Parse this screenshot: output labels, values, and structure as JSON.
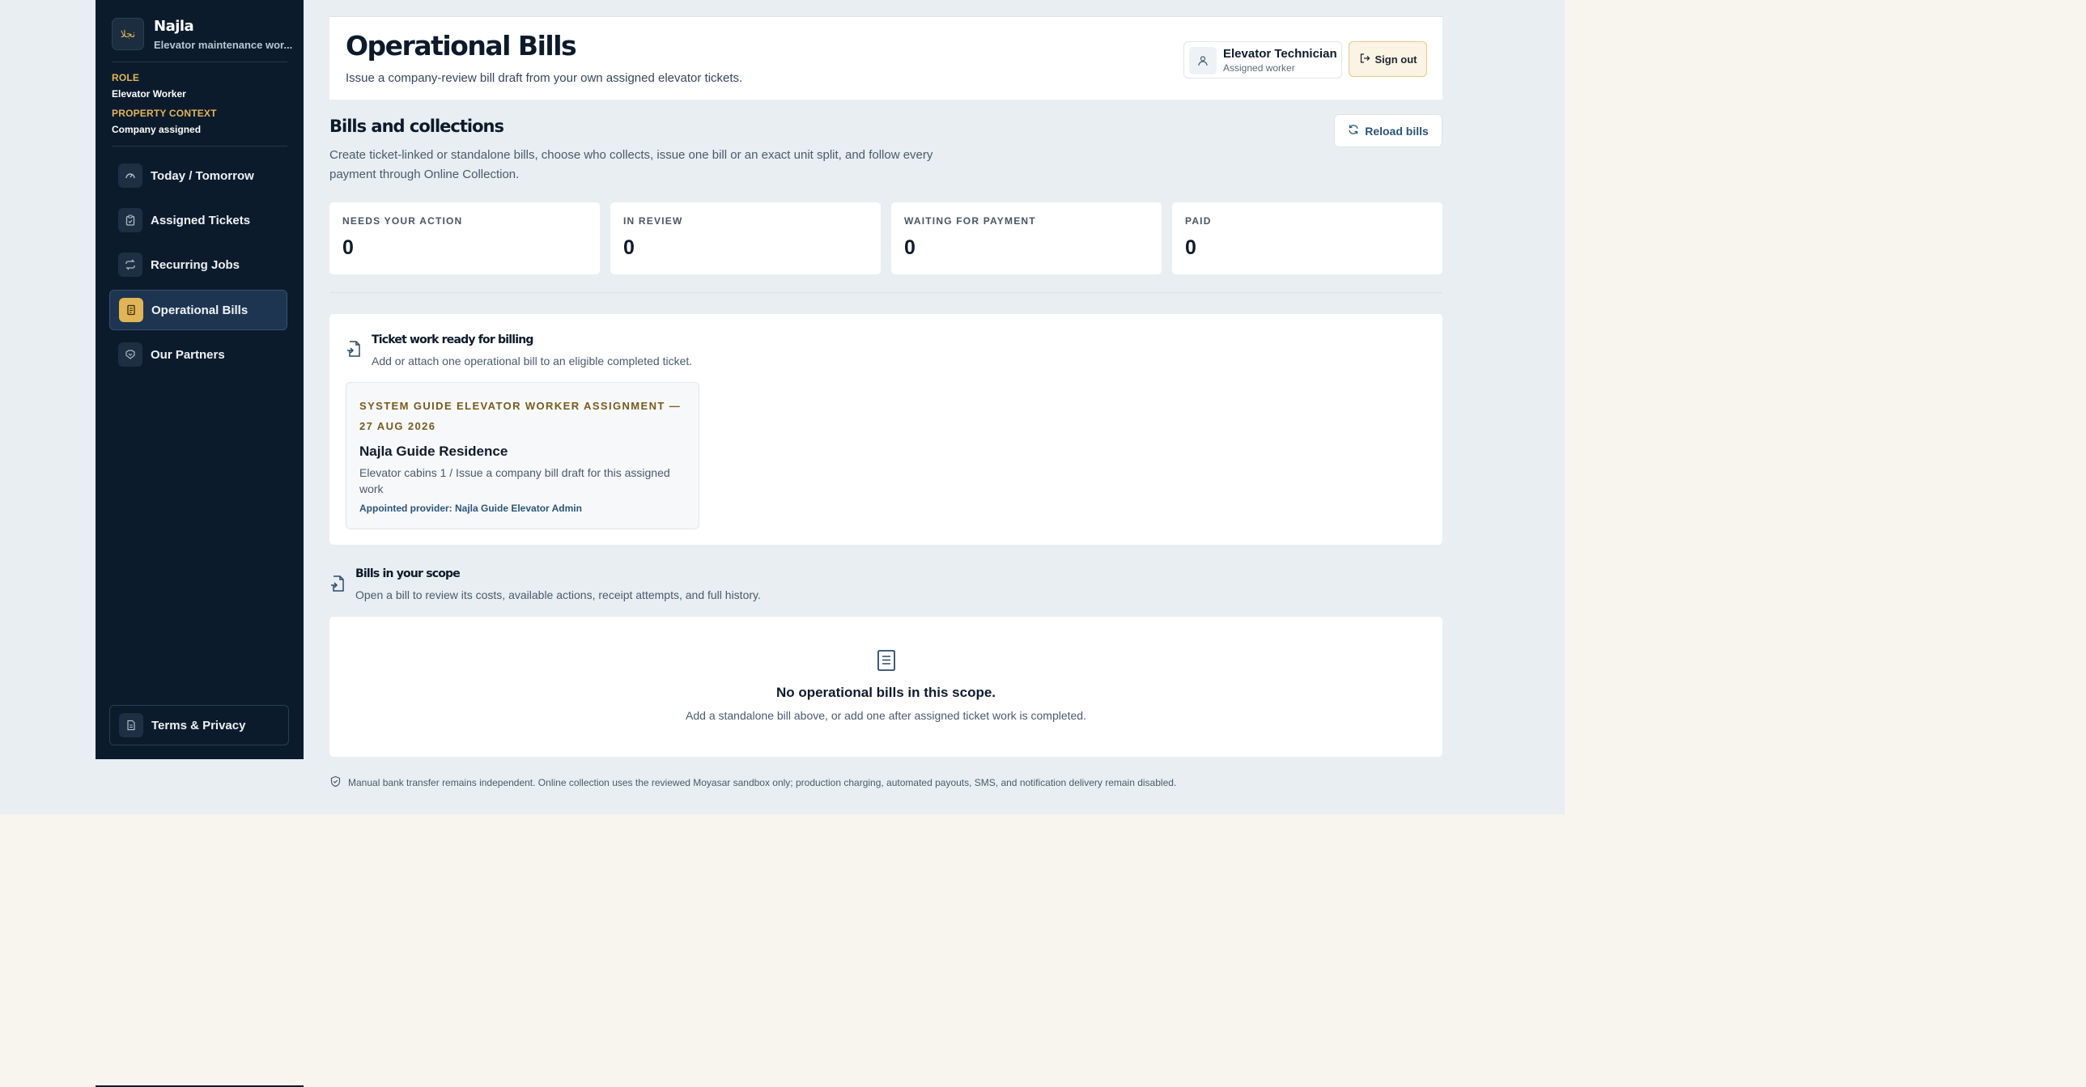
{
  "sidebar": {
    "brand_logo": "نجلا",
    "brand_name": "Najla",
    "brand_subtitle": "Elevator maintenance wor...",
    "role_label": "ROLE",
    "role_value": "Elevator Worker",
    "context_label": "PROPERTY CONTEXT",
    "context_value": "Company assigned",
    "items": [
      {
        "label": "Today / Tomorrow",
        "icon": "gauge-icon"
      },
      {
        "label": "Assigned Tickets",
        "icon": "clipboard-icon"
      },
      {
        "label": "Recurring Jobs",
        "icon": "repeat-icon"
      },
      {
        "label": "Operational Bills",
        "icon": "receipt-icon",
        "active": true
      },
      {
        "label": "Our Partners",
        "icon": "handshake-icon"
      }
    ],
    "terms_label": "Terms & Privacy"
  },
  "header": {
    "title": "Operational Bills",
    "subtitle": "Issue a company-review bill draft from your own assigned elevator tickets.",
    "user_name": "Elevator Technician",
    "user_role": "Assigned worker",
    "signout_label": "Sign out"
  },
  "bills": {
    "title": "Bills and collections",
    "description": "Create ticket-linked or standalone bills, choose who collects, issue one bill or an exact unit split, and follow every payment through Online Collection.",
    "reload_label": "Reload bills",
    "stats": [
      {
        "label": "NEEDS YOUR ACTION",
        "value": "0"
      },
      {
        "label": "IN REVIEW",
        "value": "0"
      },
      {
        "label": "WAITING FOR PAYMENT",
        "value": "0"
      },
      {
        "label": "PAID",
        "value": "0"
      }
    ]
  },
  "ticket_work": {
    "title": "Ticket work ready for billing",
    "description": "Add or attach one operational bill to an eligible completed ticket.",
    "item": {
      "kicker": "SYSTEM GUIDE ELEVATOR WORKER ASSIGNMENT — 27 AUG 2026",
      "name": "Najla Guide Residence",
      "description": "Elevator cabins 1 / Issue a company bill draft for this assigned work",
      "provider": "Appointed provider: Najla Guide Elevator Admin"
    }
  },
  "scope": {
    "title": "Bills in your scope",
    "description": "Open a bill to review its costs, available actions, receipt attempts, and full history.",
    "empty_title": "No operational bills in this scope.",
    "empty_description": "Add a standalone bill above, or add one after assigned ticket work is completed."
  },
  "footer": {
    "note": "Manual bank transfer remains independent. Online collection uses the reviewed Moyasar sandbox only; production charging, automated payouts, SMS, and notification delivery remain disabled."
  },
  "colors": {
    "sidebar_bg": "#0c1b2c",
    "accent": "#e1b457",
    "page_bg": "#e8eef1"
  }
}
